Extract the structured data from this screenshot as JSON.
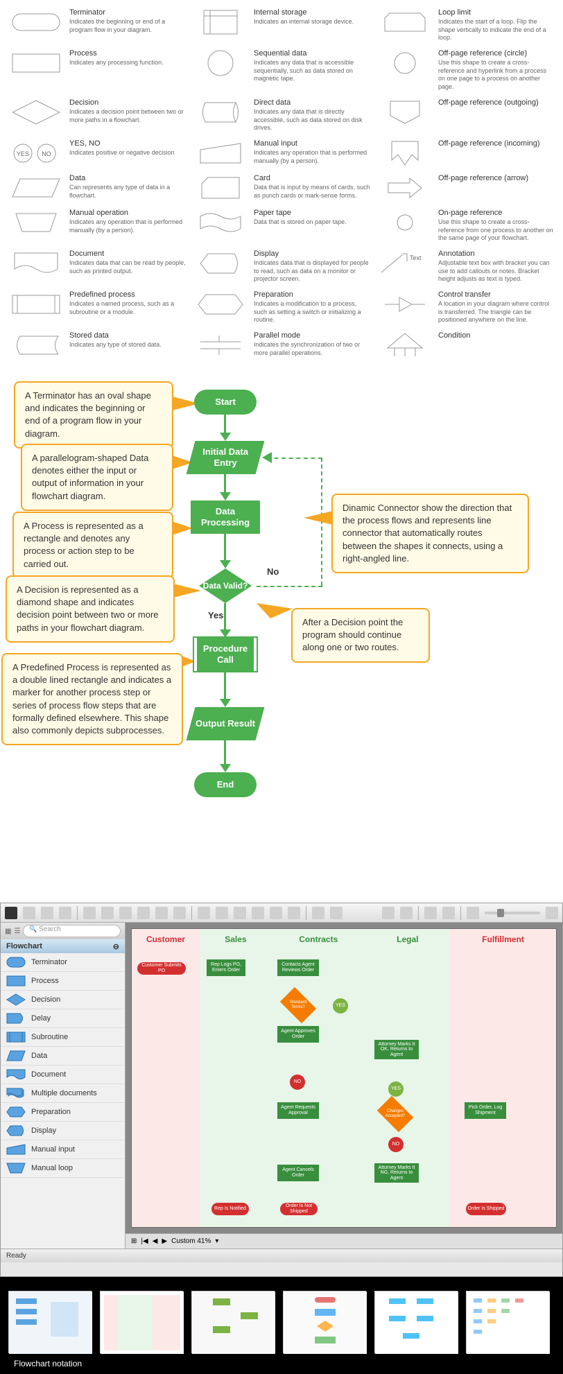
{
  "shapes": [
    {
      "title": "Terminator",
      "desc": "Indicates the beginning or end of a program flow in your diagram."
    },
    {
      "title": "Internal storage",
      "desc": "Indicates an internal storage device."
    },
    {
      "title": "Loop limit",
      "desc": "Indicates the start of a loop. Flip the shape vertically to indicate the end of a loop."
    },
    {
      "title": "Process",
      "desc": "Indicates any processing function."
    },
    {
      "title": "Sequential data",
      "desc": "Indicates any data that is accessible sequentially, such as data stored on magnetic tape."
    },
    {
      "title": "Off-page reference (circle)",
      "desc": "Use this shape to create a cross-reference and hyperlink from a process on one page to a process on another page."
    },
    {
      "title": "Decision",
      "desc": "Indicates a decision point between two or more paths in a flowchart."
    },
    {
      "title": "Direct data",
      "desc": "Indicates any data that is directly accessible, such as data stored on disk drives."
    },
    {
      "title": "Off-page reference (outgoing)",
      "desc": ""
    },
    {
      "title": "YES, NO",
      "desc": "Indicates positive or negative decision"
    },
    {
      "title": "Manual input",
      "desc": "Indicates any operation that is performed manually (by a person)."
    },
    {
      "title": "Off-page reference (incoming)",
      "desc": ""
    },
    {
      "title": "Data",
      "desc": "Can represents any type of data in a flowchart."
    },
    {
      "title": "Card",
      "desc": "Data that is input by means of cards, such as punch cards or mark-sense forms."
    },
    {
      "title": "Off-page reference (arrow)",
      "desc": ""
    },
    {
      "title": "Manual operation",
      "desc": "Indicates any operation that is performed manually (by a person)."
    },
    {
      "title": "Paper tape",
      "desc": "Data that is stored on paper tape."
    },
    {
      "title": "On-page reference",
      "desc": "Use this shape to create a cross-reference from one process to another on the same page of your flowchart."
    },
    {
      "title": "Document",
      "desc": "Indicates data that can be read by people, such as printed output."
    },
    {
      "title": "Display",
      "desc": "Indicates data that is displayed for people to read, such as data on a monitor or projector screen."
    },
    {
      "title": "Annotation",
      "desc": "Adjustable text box with bracket you can use to add callouts or notes. Bracket height adjusts as text is typed."
    },
    {
      "title": "Predefined process",
      "desc": "Indicates a named process, such as a subroutine or a module."
    },
    {
      "title": "Preparation",
      "desc": "Indicates a modification to a process, such as setting a switch or initializing a routine."
    },
    {
      "title": "Control transfer",
      "desc": "A location in your diagram where control is transferred. The triangle can be positioned anywhere on the line."
    },
    {
      "title": "Stored data",
      "desc": "Indicates any type of stored data."
    },
    {
      "title": "Parallel mode",
      "desc": "Indicates the synchronization of two or more parallel operations."
    },
    {
      "title": "Condition",
      "desc": ""
    }
  ],
  "annotation_label": "Text",
  "yesno": {
    "yes": "YES",
    "no": "NO"
  },
  "callouts": {
    "terminator": "A Terminator has an oval shape and indicates the beginning or end of a program flow in your diagram.",
    "data": "A parallelogram-shaped Data denotes either the input or output of information in your flowchart diagram.",
    "process": "A Process is represented as a rectangle and denotes any process or action step to be carried out.",
    "decision": "A Decision is represented as a diamond shape and indicates decision point between two or more paths in your flowchart diagram.",
    "predef": "A Predefined Process is represented as a double lined rectangle and indicates a marker for another process step or series of process flow steps that are formally defined elsewhere. This shape also commonly depicts subprocesses.",
    "connector": "Dinamic Connector show the direction that the process flows and represents line connector that automatically routes between the shapes it connects, using a right-angled line.",
    "afterdecision": "After a Decision point the program should continue along one or two routes."
  },
  "flow": {
    "start": "Start",
    "initial": "Initial Data Entry",
    "processing": "Data Processing",
    "valid": "Data Valid?",
    "procedure": "Procedure Call",
    "output": "Output Result",
    "end": "End",
    "yes": "Yes",
    "no": "No"
  },
  "app": {
    "search_placeholder": "Search",
    "panel": "Flowchart",
    "items": [
      "Terminator",
      "Process",
      "Decision",
      "Delay",
      "Subroutine",
      "Data",
      "Document",
      "Multiple documents",
      "Preparation",
      "Display",
      "Manual input",
      "Manual loop"
    ],
    "status": "Ready",
    "zoom": "Custom 41%",
    "lanes": [
      "Customer",
      "Sales",
      "Contracts",
      "Legal",
      "Fulfillment"
    ],
    "nodes": {
      "submit": "Customer Submits PO",
      "logs": "Rep Logs PO, Enters Order",
      "contacts": "Contacts Agent Reviews Order",
      "standard": "Standard Terms?",
      "approves": "Agent Approves Order",
      "attorney1": "Attorney Marks It OK, Returns to Agent",
      "requests": "Agent Requests Approval",
      "changes": "Changes Accepted?",
      "pick": "Pick Order, Log Shipment",
      "cancels": "Agent Cancels Order",
      "attorney2": "Attorney Marks It NG, Returns to Agent",
      "notified": "Rep Is Notified",
      "notshipped": "Order Is Not Shipped",
      "shipped": "Order Is Shipped",
      "yes": "YES",
      "no": "NO"
    }
  },
  "gallery_label": "Flowchart notation"
}
